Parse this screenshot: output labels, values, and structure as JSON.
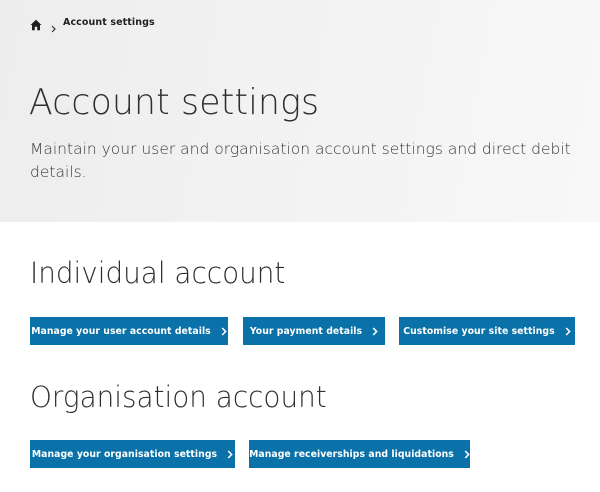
{
  "breadcrumb": {
    "home_icon": "home-icon",
    "current": "Account settings"
  },
  "header": {
    "title": "Account settings",
    "description": "Maintain your user and organisation account settings and direct debit details."
  },
  "individual": {
    "heading": "Individual account",
    "buttons": [
      {
        "label": "Manage your user account details",
        "icon": "chevron-right-icon"
      },
      {
        "label": "Your payment details",
        "icon": "chevron-right-icon"
      },
      {
        "label": "Customise your site settings",
        "icon": "chevron-right-icon"
      }
    ]
  },
  "organisation": {
    "heading": "Organisation account",
    "buttons": [
      {
        "label": "Manage your organisation settings",
        "icon": "chevron-right-icon"
      },
      {
        "label": "Manage receiverships and liquidations",
        "icon": "chevron-right-icon"
      }
    ]
  },
  "colors": {
    "button_bg": "#0a72a9",
    "button_text": "#ffffff",
    "hero_bg": "#f1f1f1"
  }
}
